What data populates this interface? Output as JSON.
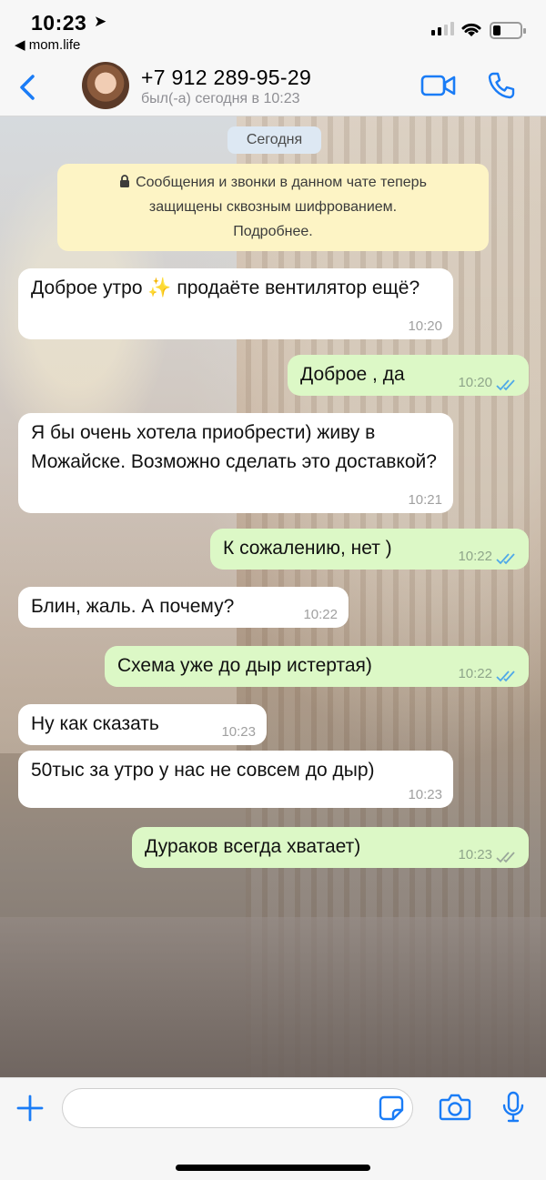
{
  "status_bar": {
    "time": "10:23",
    "back_app": "◀ mom.life"
  },
  "header": {
    "contact_name": "+7 912 289-95-29",
    "contact_status": "был(-а) сегодня в 10:23",
    "accent_color": "#1a7cf6"
  },
  "chat": {
    "date_label": "Сегодня",
    "encryption_notice": {
      "line1": "Сообщения и звонки в данном чате теперь",
      "line2": "защищены сквозным шифрованием.",
      "line3": "Подробнее."
    },
    "messages": [
      {
        "direction": "in",
        "text": "Доброе утро ✨ продаёте вентилятор ещё?",
        "time": "10:20"
      },
      {
        "direction": "out",
        "text": "Доброе , да",
        "time": "10:20",
        "status": "read"
      },
      {
        "direction": "in",
        "text": "Я бы очень хотела приобрести) живу в Можайске. Возможно сделать это доставкой?",
        "time": "10:21"
      },
      {
        "direction": "out",
        "text": "К сожалению, нет )",
        "time": "10:22",
        "status": "read"
      },
      {
        "direction": "in",
        "text": "Блин, жаль. А почему?",
        "time": "10:22"
      },
      {
        "direction": "out",
        "text": "Схема уже до дыр истертая)",
        "time": "10:22",
        "status": "read"
      },
      {
        "direction": "in",
        "text": "Ну как сказать",
        "time": "10:23"
      },
      {
        "direction": "in",
        "text": "50тыс за утро у нас не совсем до дыр)",
        "time": "10:23"
      },
      {
        "direction": "out",
        "text": "Дураков всегда хватает)",
        "time": "10:23",
        "status": "delivered"
      }
    ]
  },
  "input_bar": {
    "placeholder": "",
    "value": ""
  }
}
